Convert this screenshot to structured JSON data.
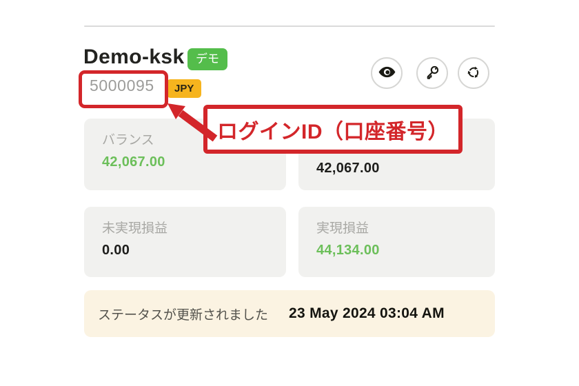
{
  "account": {
    "name": "Demo-ksk",
    "type_badge": "デモ",
    "login_id": "5000095",
    "currency_badge": "JPY"
  },
  "toolbar": {
    "buttons": [
      {
        "icon": "eye-icon"
      },
      {
        "icon": "key-icon"
      },
      {
        "icon": "recycle-icon"
      }
    ]
  },
  "cards": [
    {
      "label": "バランス",
      "value": "42,067.00",
      "value_color": "#6cbf5a"
    },
    {
      "label": "",
      "value": "42,067.00",
      "value_color": "#1d1d1b"
    },
    {
      "label": "未実現損益",
      "value": "0.00",
      "value_color": "#1d1d1b"
    },
    {
      "label": "実現損益",
      "value": "44,134.00",
      "value_color": "#6cbf5a"
    }
  ],
  "status_banner": {
    "message": "ステータスが更新されました",
    "timestamp": "23 May 2024 03:04 AM"
  },
  "annotation": {
    "label": "ログインID（口座番号）"
  },
  "colors": {
    "annotation_red": "#d3262a",
    "badge_green": "#54bd4b",
    "value_green": "#6cbf5a",
    "currency_amber": "#f6b41e",
    "card_bg": "#f1f1ef",
    "banner_bg": "#fbf3e2"
  }
}
